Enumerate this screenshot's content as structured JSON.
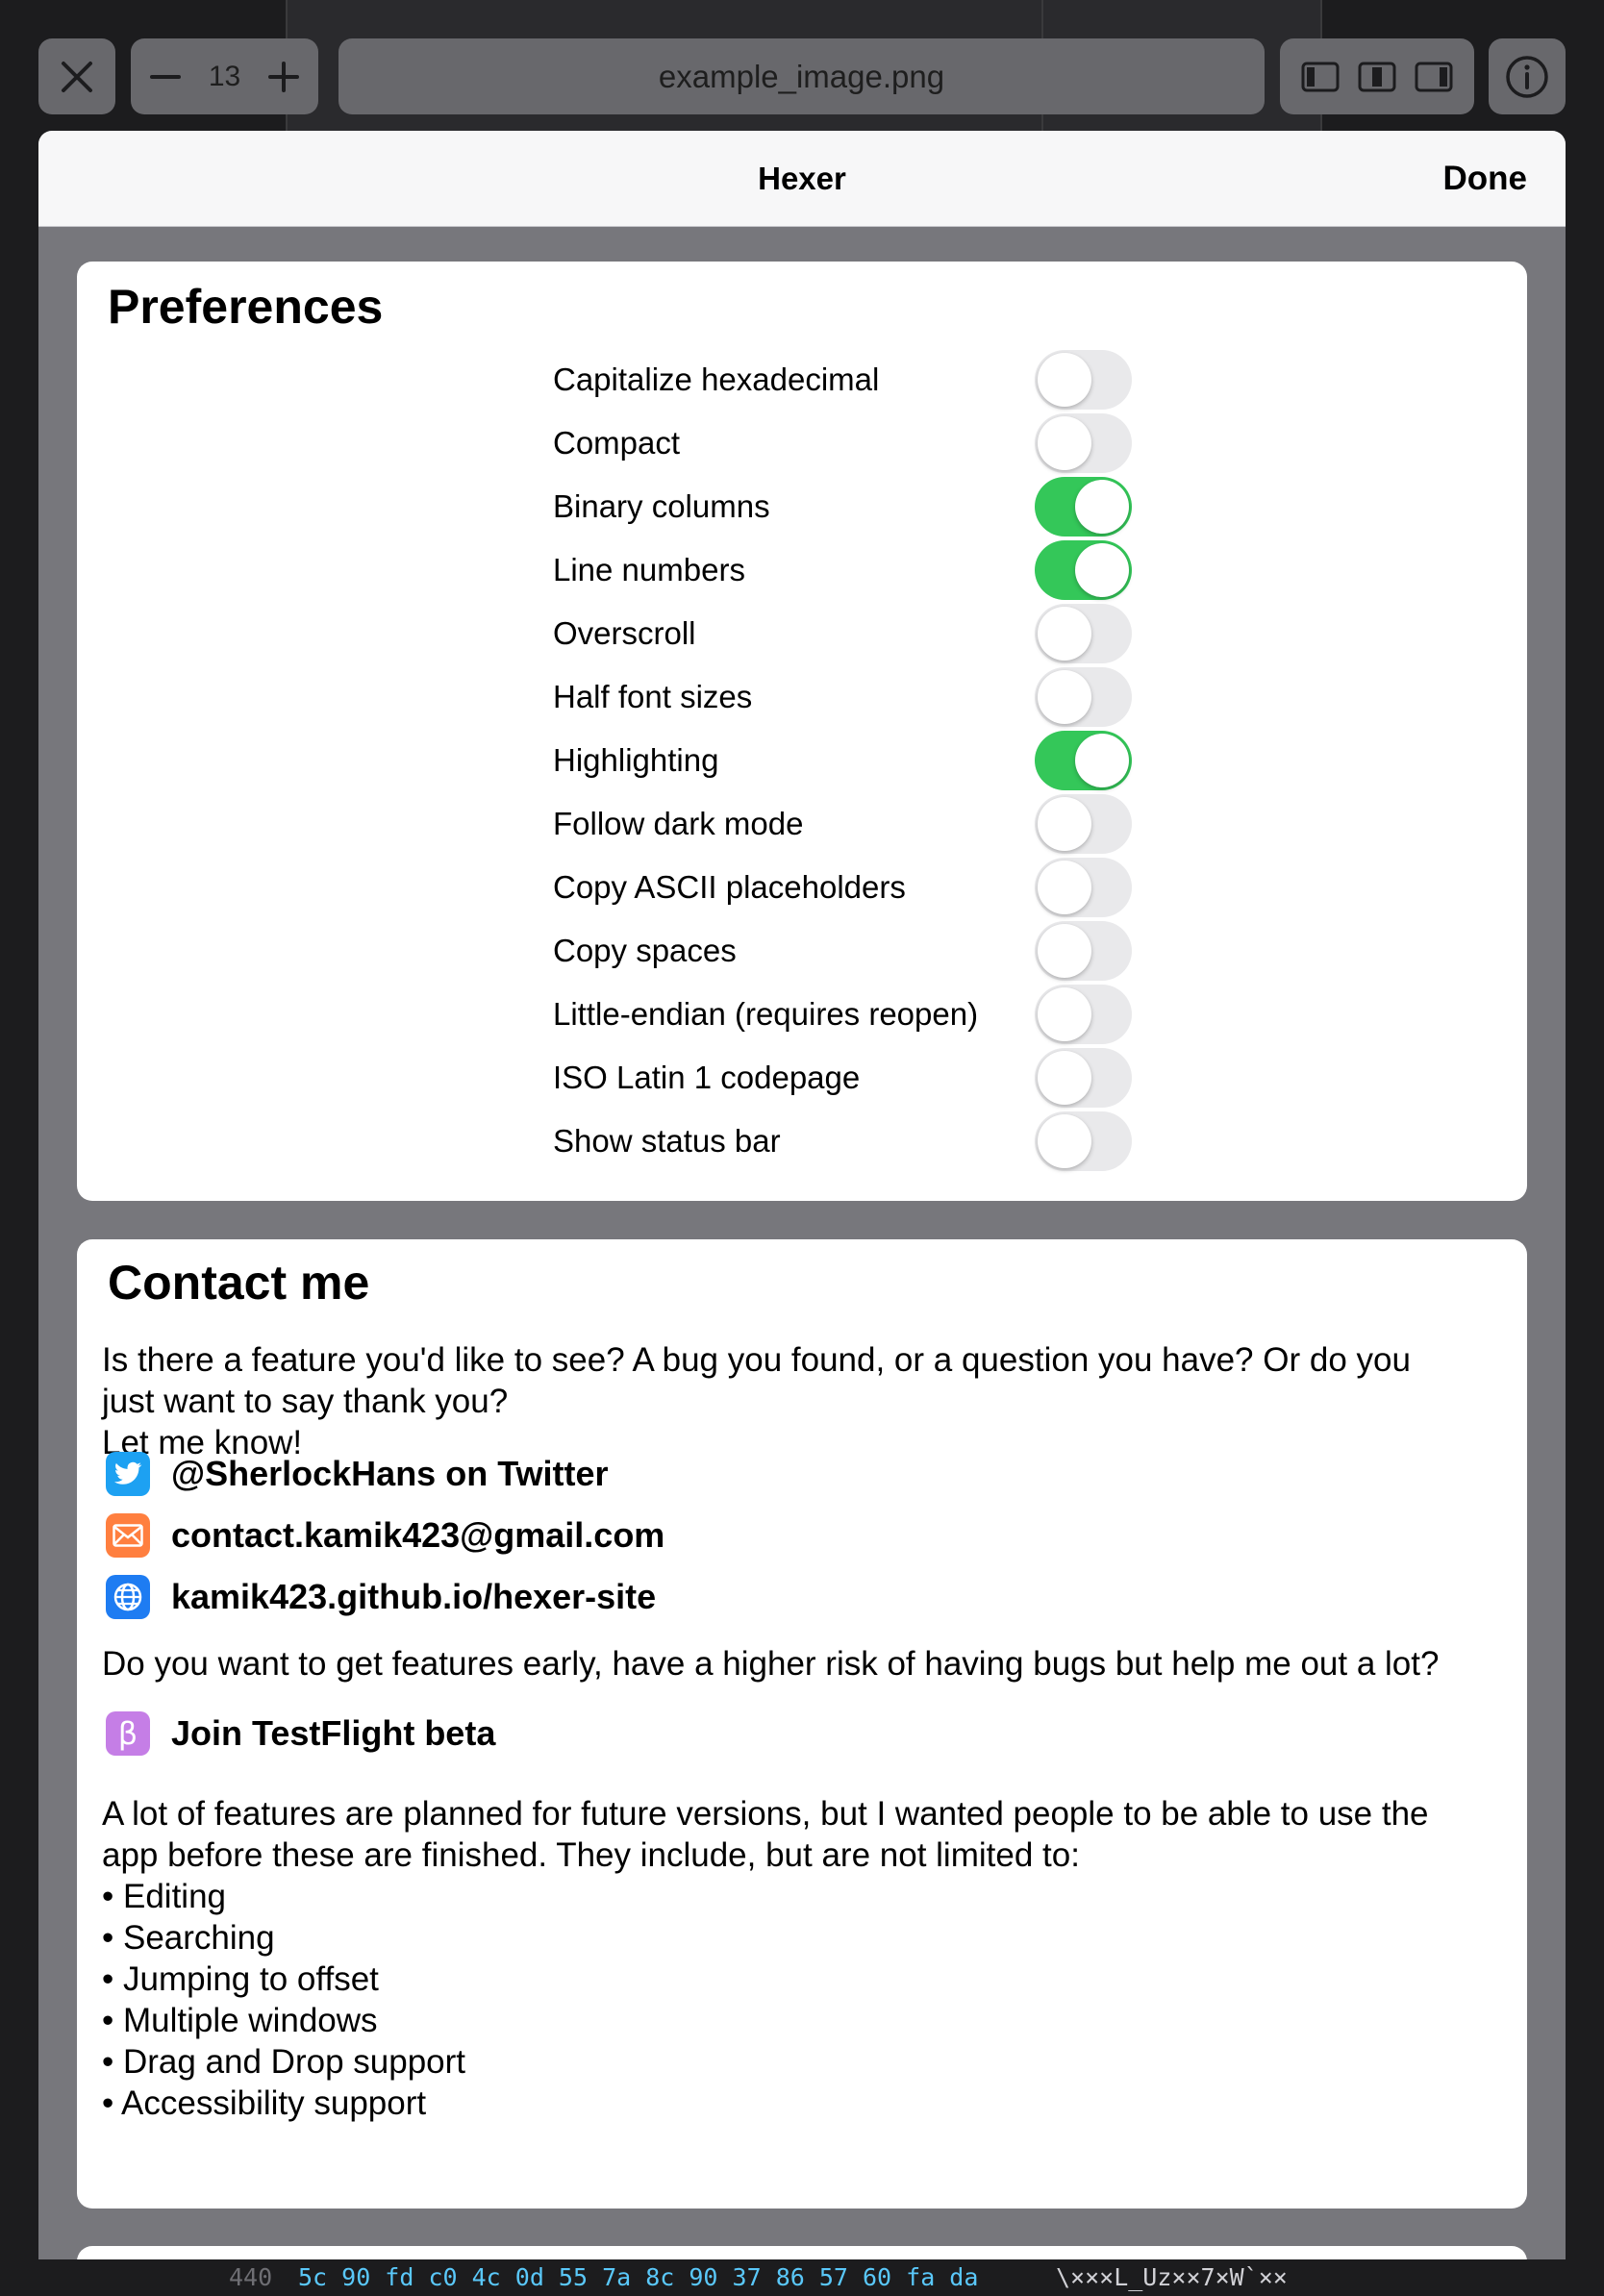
{
  "toolbar": {
    "zoom": "13",
    "filename": "example_image.png"
  },
  "sheet": {
    "title": "Hexer",
    "done_label": "Done"
  },
  "preferences": {
    "heading": "Preferences",
    "items": [
      {
        "label": "Capitalize hexadecimal",
        "on": false
      },
      {
        "label": "Compact",
        "on": false
      },
      {
        "label": "Binary columns",
        "on": true
      },
      {
        "label": "Line numbers",
        "on": true
      },
      {
        "label": "Overscroll",
        "on": false
      },
      {
        "label": "Half font sizes",
        "on": false
      },
      {
        "label": "Highlighting",
        "on": true
      },
      {
        "label": "Follow dark mode",
        "on": false
      },
      {
        "label": "Copy ASCII placeholders",
        "on": false
      },
      {
        "label": "Copy spaces",
        "on": false
      },
      {
        "label": "Little-endian (requires reopen)",
        "on": false
      },
      {
        "label": "ISO Latin 1 codepage",
        "on": false
      },
      {
        "label": "Show status bar",
        "on": false
      }
    ]
  },
  "contact": {
    "heading": "Contact me",
    "intro_line1": "Is there a feature you'd like to see? A bug you found, or a question you have? Or do you",
    "intro_line2": "just want to say thank you?",
    "intro_line3": "Let me know!",
    "links": [
      {
        "text": "@SherlockHans on Twitter",
        "icon": "twitter-icon",
        "color": "#1da1f2"
      },
      {
        "text": "contact.kamik423@gmail.com",
        "icon": "mail-icon",
        "color": "#ff7f3f"
      },
      {
        "text": "kamik423.github.io/hexer-site",
        "icon": "globe-icon",
        "color": "#1e7cf2"
      }
    ],
    "beta_question": "Do you want to get features early, have a higher risk of having bugs but help me out a lot?",
    "beta_link": {
      "text": "Join TestFlight beta",
      "icon": "beta-icon",
      "color": "#c57ee6"
    },
    "planned_line1": "A lot of features are planned for future versions, but I wanted people to be able to use the",
    "planned_line2": "app before these are finished. They include, but are not limited to:",
    "planned_items": [
      "• Editing",
      "• Searching",
      "• Jumping to offset",
      "• Multiple windows",
      "• Drag and Drop support",
      "• Accessibility support"
    ]
  },
  "background_code": {
    "line_number": "440",
    "hex": "5c 90 fd c0 4c 0d 55 7a 8c 90 37 86 57 60 fa da",
    "ascii": "\\×××L_Uz××7×W`××"
  },
  "colors": {
    "toggle_on": "#34c759",
    "toggle_off": "#e9e9eb"
  }
}
